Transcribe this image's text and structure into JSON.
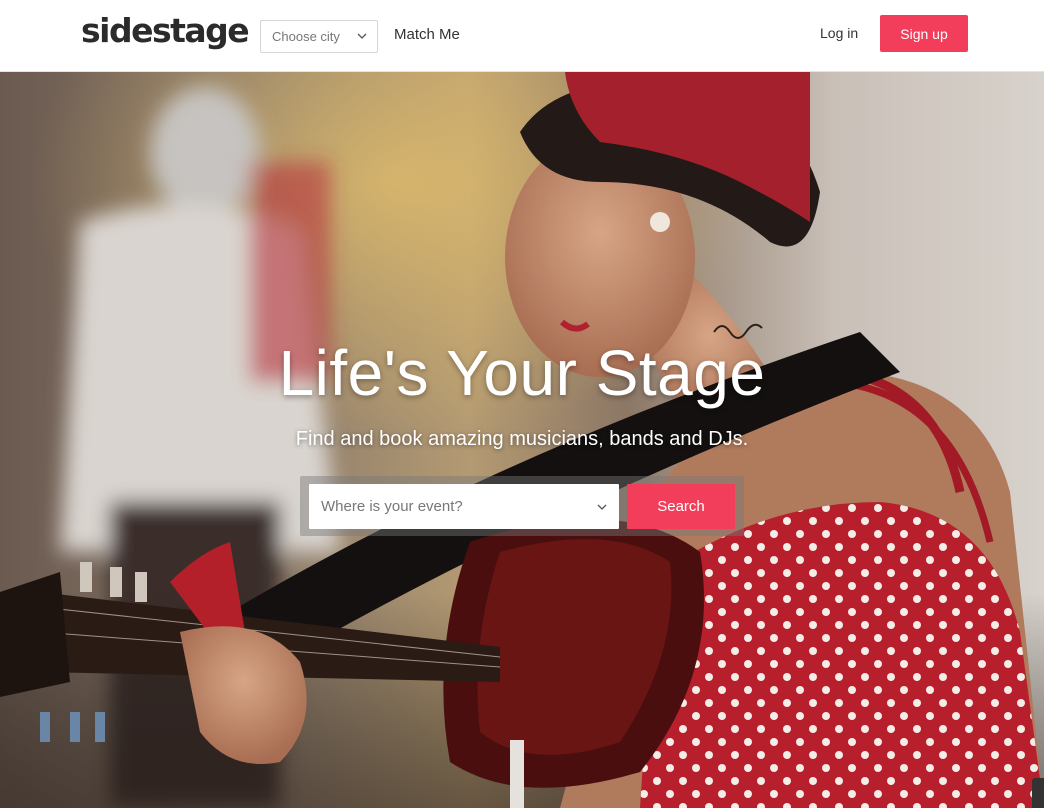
{
  "header": {
    "logo": "sidestage",
    "city_select": {
      "value": "Choose city",
      "icon": "chevron-down-icon"
    },
    "match_me": "Match Me",
    "login": "Log in",
    "signup": "Sign up"
  },
  "hero": {
    "title": "Life's Your Stage",
    "subtitle": "Find and book amazing musicians, bands and DJs.",
    "event_select": {
      "placeholder": "Where is your event?",
      "icon": "chevron-down-icon"
    },
    "search_button": "Search",
    "image": "photo of a woman with red headscarf playing acoustic guitar"
  },
  "colors": {
    "accent": "#f23e5a",
    "logo": "#2b2b2b",
    "header_bg": "#ffffff"
  }
}
